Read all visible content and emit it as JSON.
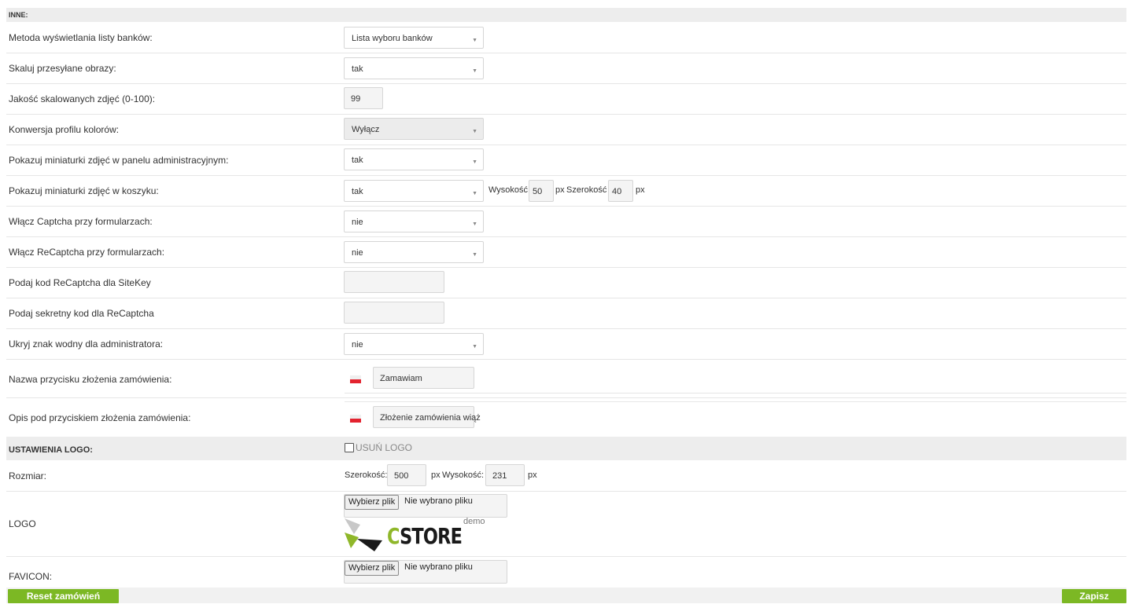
{
  "inne": {
    "header": "INNE:",
    "rows": [
      {
        "label": "Metoda wyświetlania listy banków:",
        "value": "Lista wyboru banków"
      },
      {
        "label": "Skaluj przesyłane obrazy:",
        "value": "tak"
      },
      {
        "label": "Jakość skalowanych zdjęć (0-100):",
        "value": "99"
      },
      {
        "label": "Konwersja profilu kolorów:",
        "value": "Wyłącz"
      },
      {
        "label": "Pokazuj miniaturki zdjęć w panelu administracyjnym:",
        "value": "tak"
      },
      {
        "label": "Pokazuj miniaturki zdjęć w koszyku:",
        "value": "tak",
        "height_label": "Wysokość",
        "height_value": "50",
        "px1": "px",
        "width_label": "Szerokość",
        "width_value": "40",
        "px2": "px"
      },
      {
        "label": "Włącz Captcha przy formularzach:",
        "value": "nie"
      },
      {
        "label": "Włącz ReCaptcha przy formularzach:",
        "value": "nie"
      },
      {
        "label": "Podaj kod ReCaptcha dla SiteKey",
        "value": ""
      },
      {
        "label": "Podaj sekretny kod dla ReCaptcha",
        "value": ""
      },
      {
        "label": "Ukryj znak wodny dla administratora:",
        "value": "nie"
      },
      {
        "label": "Nazwa przycisku złożenia zamówienia:",
        "value": "Zamawiam"
      },
      {
        "label": "Opis pod przyciskiem złożenia zamówienia:",
        "value": "Złożenie zamówienia wiąż"
      }
    ]
  },
  "logo_settings": {
    "header": "USTAWIENIA LOGO:",
    "remove_logo_label": "USUŃ LOGO",
    "size": {
      "label": "Rozmiar:",
      "width_label": "Szerokość:",
      "width_value": "500",
      "px1": "px",
      "height_label": "Wysokość:",
      "height_value": "231",
      "px2": "px"
    },
    "logo": {
      "label": "LOGO",
      "button": "Wybierz plik",
      "status": "Nie wybrano pliku"
    },
    "brand": {
      "word_c": "C",
      "word_rest": "STORE",
      "demo": "demo"
    },
    "favicon": {
      "label": "FAVICON:",
      "button": "Wybierz plik",
      "status": "Nie wybrano pliku"
    }
  },
  "actions": {
    "reset": "Reset zamówień",
    "save": "Zapisz"
  },
  "colors": {
    "accent": "#7cb824",
    "header_bg": "#ededed",
    "flag_red": "#e3232f"
  }
}
